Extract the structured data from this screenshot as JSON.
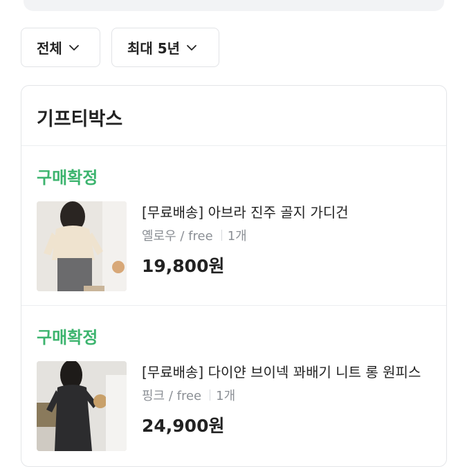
{
  "filters": {
    "all_label": "전체",
    "period_label": "최대 5년"
  },
  "store": {
    "name": "기프티박스"
  },
  "orders": [
    {
      "status": "구매확정",
      "title": "[무료배송] 아브라 진주 골지 가디건",
      "option": "옐로우 / free",
      "quantity": "1개",
      "price": "19,800원"
    },
    {
      "status": "구매확정",
      "title": "[무료배송] 다이얀 브이넥 꽈배기 니트 롱 원피스",
      "option": "핑크 / free",
      "quantity": "1개",
      "price": "24,900원"
    }
  ],
  "colors": {
    "status_green": "#3cb46e",
    "muted_text": "#8b8f95",
    "border": "#e3e5e8"
  }
}
